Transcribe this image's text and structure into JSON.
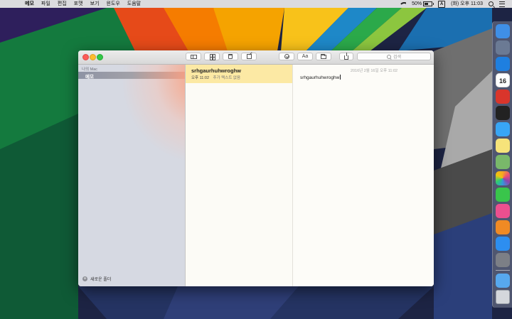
{
  "menubar": {
    "apple_glyph": "",
    "items": [
      "메모",
      "파일",
      "편집",
      "포맷",
      "보기",
      "윈도우",
      "도움말"
    ],
    "battery": "50%",
    "input_source": "A",
    "clock": "(화) 오후 11:03"
  },
  "window": {
    "sidebar": {
      "section_header": "나의 Mac",
      "selected_folder": "메모",
      "new_folder_label": "새로운 폴더"
    },
    "search_placeholder": "검색",
    "aa_label": "Aa",
    "note_list": [
      {
        "title": "srhgaurhuhwroghw",
        "time": "오후 11:02",
        "preview": "추가 텍스트 없음"
      }
    ],
    "editor": {
      "date": "2016년 2월 16일 오후 11:02",
      "body": "srhgaurhuhwroghw"
    }
  },
  "dock": {
    "apps": [
      {
        "name": "finder",
        "color": "#3f8fe6"
      },
      {
        "name": "launchpad",
        "color": "#6b7a94"
      },
      {
        "name": "safari",
        "color": "#1e7fe0"
      },
      {
        "name": "calendar",
        "color": "#ffffff",
        "label": "16"
      },
      {
        "name": "photo-booth",
        "color": "#d9352b"
      },
      {
        "name": "terminal",
        "color": "#222222"
      },
      {
        "name": "messages",
        "color": "#38a5f5"
      },
      {
        "name": "notes",
        "color": "#f6e37a"
      },
      {
        "name": "maps",
        "color": "#79b86a"
      },
      {
        "name": "photos",
        "color": "#f0f0f0"
      },
      {
        "name": "facetime",
        "color": "#39c54b"
      },
      {
        "name": "itunes",
        "color": "#ec4f8f"
      },
      {
        "name": "ibooks",
        "color": "#f08a24"
      },
      {
        "name": "app-store",
        "color": "#2d8ef0"
      },
      {
        "name": "system-preferences",
        "color": "#7c7f86"
      },
      {
        "name": "downloads",
        "color": "#57a8ee"
      },
      {
        "name": "trash",
        "color": "#d4d7dc"
      }
    ]
  }
}
